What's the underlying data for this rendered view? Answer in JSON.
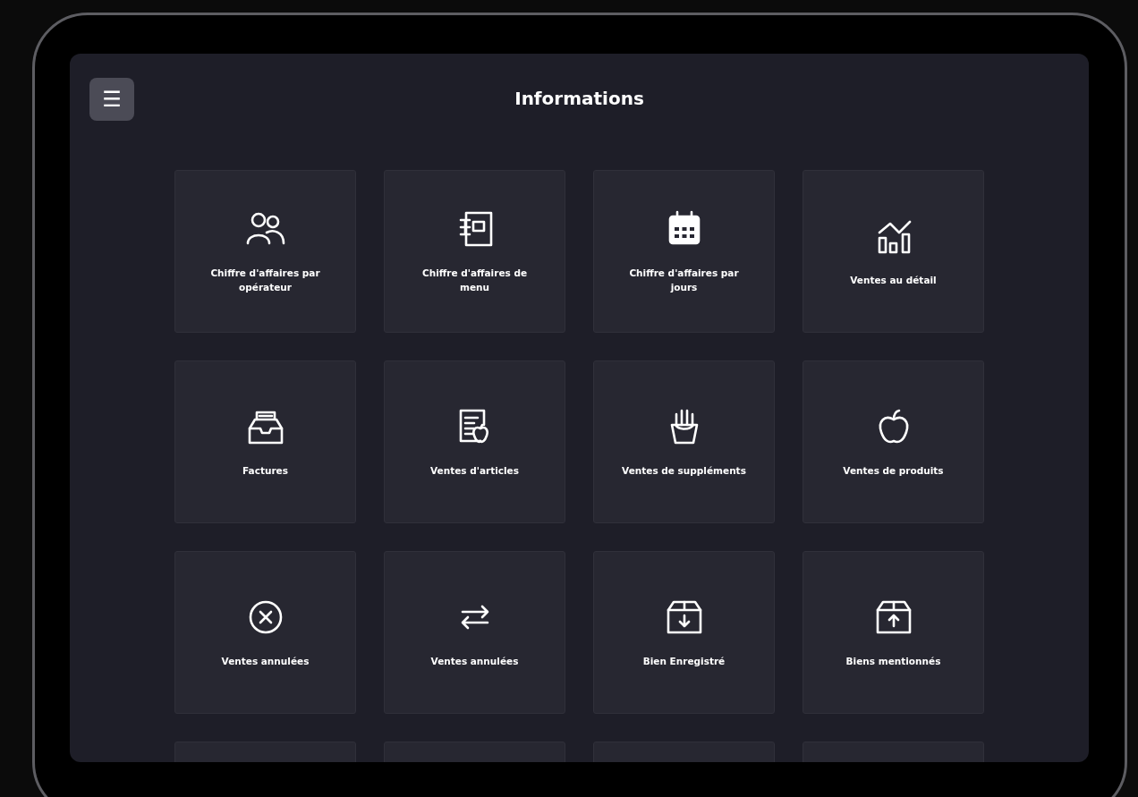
{
  "header": {
    "title": "Informations",
    "menu_button": "☰"
  },
  "tiles": [
    {
      "label": "Chiffre d'affaires par opérateur"
    },
    {
      "label": "Chiffre d'affaires de menu"
    },
    {
      "label": "Chiffre d'affaires par jours"
    },
    {
      "label": "Ventes au détail"
    },
    {
      "label": "Factures"
    },
    {
      "label": "Ventes d'articles"
    },
    {
      "label": "Ventes de suppléments"
    },
    {
      "label": "Ventes de produits"
    },
    {
      "label": "Ventes annulées"
    },
    {
      "label": "Ventes annulées"
    },
    {
      "label": "Bien Enregistré"
    },
    {
      "label": "Biens mentionnés"
    }
  ],
  "cut_off_tiles": [
    {
      "kind": "tile"
    },
    {
      "kind": "tile"
    },
    {
      "kind": "tile"
    },
    {
      "kind": "tile"
    }
  ]
}
